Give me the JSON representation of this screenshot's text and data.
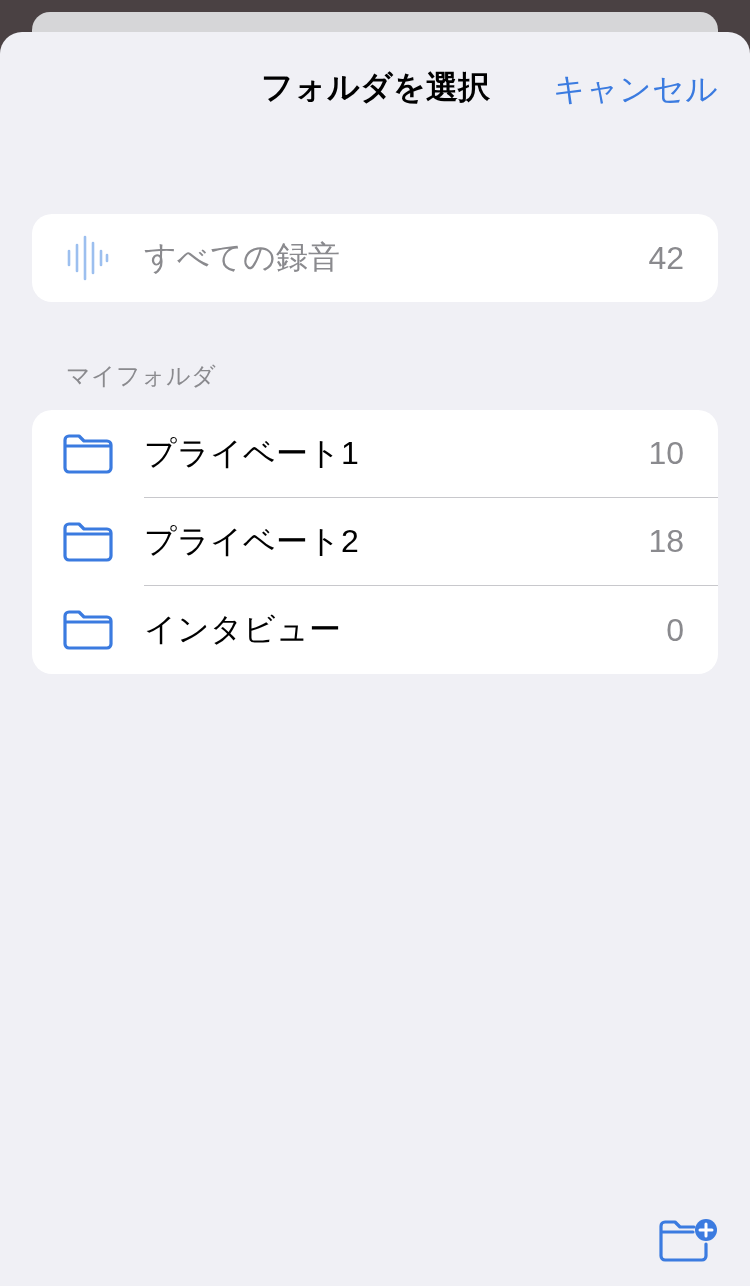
{
  "header": {
    "title": "フォルダを選択",
    "cancel": "キャンセル"
  },
  "all_recordings": {
    "label": "すべての録音",
    "count": "42",
    "disabled": true
  },
  "section": {
    "title": "マイフォルダ"
  },
  "folders": [
    {
      "name": "プライベート1",
      "count": "10"
    },
    {
      "name": "プライベート2",
      "count": "18"
    },
    {
      "name": "インタビュー",
      "count": "0"
    }
  ]
}
